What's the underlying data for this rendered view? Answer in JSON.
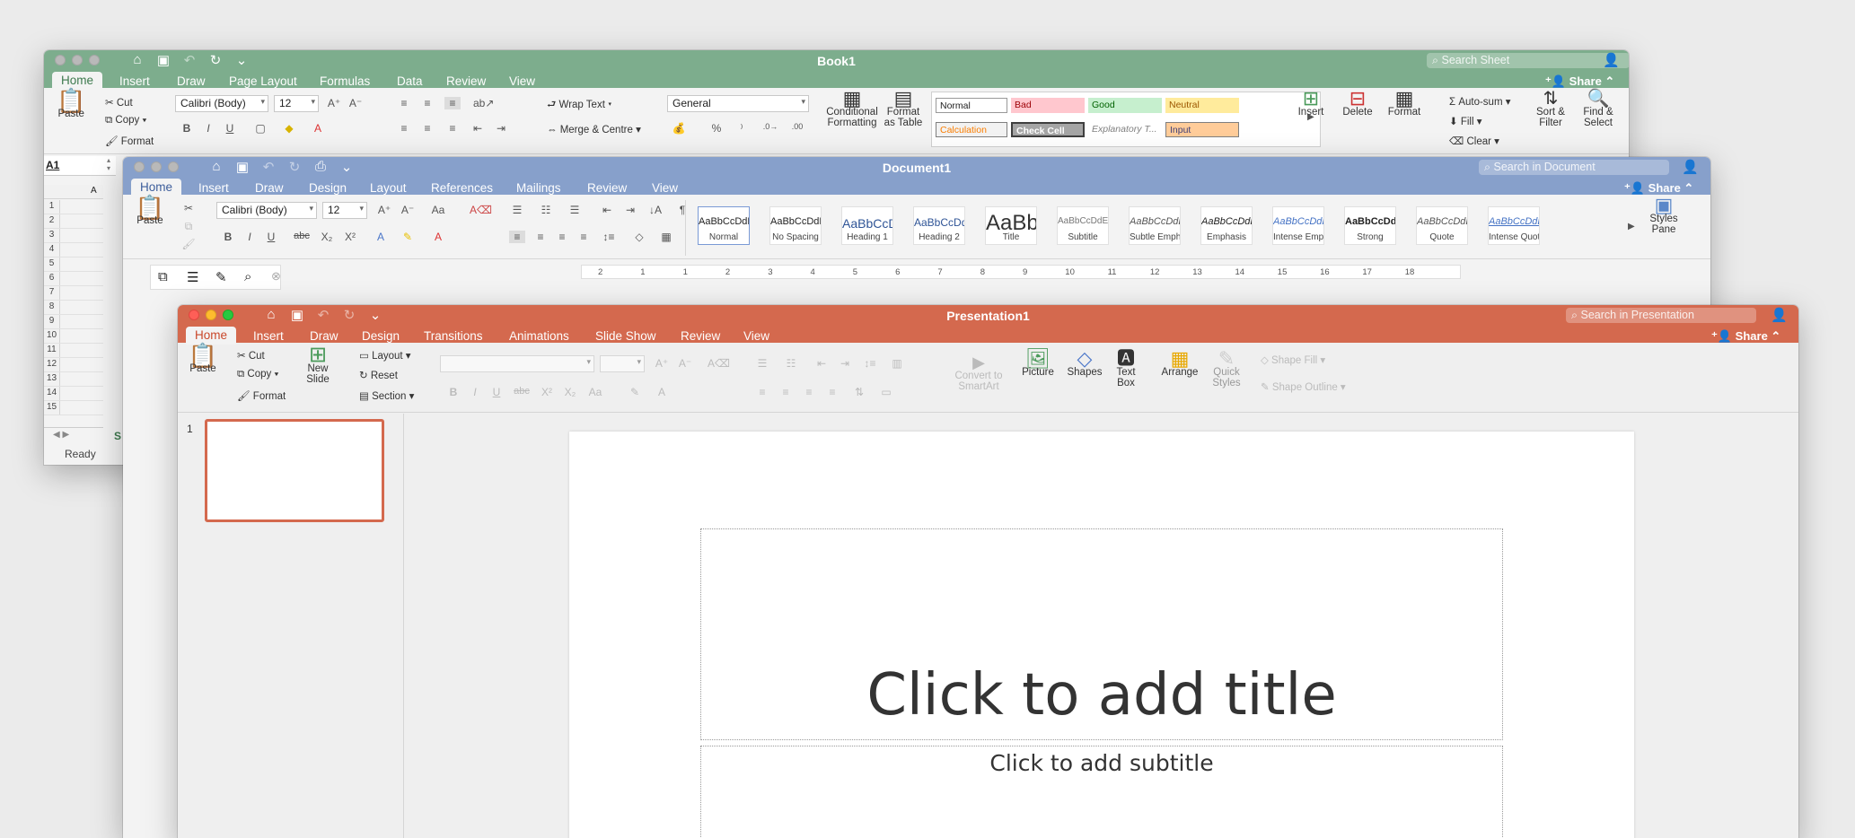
{
  "excel": {
    "title": "Book1",
    "search_placeholder": "Search Sheet",
    "tabs": [
      "Home",
      "Insert",
      "Draw",
      "Page Layout",
      "Formulas",
      "Data",
      "Review",
      "View"
    ],
    "share": "Share",
    "clipboard": {
      "paste": "Paste",
      "cut": "Cut",
      "copy": "Copy",
      "format": "Format"
    },
    "font": "Calibri (Body)",
    "font_size": "12",
    "wrap_text": "Wrap Text",
    "merge": "Merge & Centre",
    "number_format": "General",
    "cond_format": [
      "Conditional",
      "Formatting"
    ],
    "format_table": [
      "Format",
      "as Table"
    ],
    "cell_styles": [
      "Normal",
      "Bad",
      "Good",
      "Neutral",
      "Calculation",
      "Check Cell",
      "Explanatory T...",
      "Input"
    ],
    "cells": {
      "insert": "Insert",
      "delete": "Delete",
      "format": "Format"
    },
    "editing": {
      "autosum": "Auto-sum",
      "fill": "Fill",
      "clear": "Clear",
      "sort": [
        "Sort &",
        "Filter"
      ],
      "find": [
        "Find &",
        "Select"
      ]
    },
    "name_box": "A1",
    "col_header": "A",
    "rows": [
      "1",
      "2",
      "3",
      "4",
      "5",
      "6",
      "7",
      "8",
      "9",
      "10",
      "11",
      "12",
      "13",
      "14",
      "15"
    ],
    "sheet_tab": "S",
    "status": "Ready",
    "accent": "#7dad8d"
  },
  "word": {
    "title": "Document1",
    "search_placeholder": "Search in Document",
    "tabs": [
      "Home",
      "Insert",
      "Draw",
      "Design",
      "Layout",
      "References",
      "Mailings",
      "Review",
      "View"
    ],
    "share": "Share",
    "paste": "Paste",
    "font": "Calibri (Body)",
    "font_size": "12",
    "styles": [
      {
        "sample": "AaBbCcDdEe",
        "name": "Normal"
      },
      {
        "sample": "AaBbCcDdEe",
        "name": "No Spacing"
      },
      {
        "sample": "AaBbCcDc",
        "name": "Heading 1"
      },
      {
        "sample": "AaBbCcDdEe",
        "name": "Heading 2"
      },
      {
        "sample": "AaBb(",
        "name": "Title"
      },
      {
        "sample": "AaBbCcDdEe",
        "name": "Subtitle"
      },
      {
        "sample": "AaBbCcDdEe",
        "name": "Subtle Emph..."
      },
      {
        "sample": "AaBbCcDdEe",
        "name": "Emphasis"
      },
      {
        "sample": "AaBbCcDdEe",
        "name": "Intense Emp..."
      },
      {
        "sample": "AaBbCcDdEe",
        "name": "Strong"
      },
      {
        "sample": "AaBbCcDdEe",
        "name": "Quote"
      },
      {
        "sample": "AaBbCcDdEe",
        "name": "Intense Quote"
      }
    ],
    "styles_pane": [
      "Styles",
      "Pane"
    ],
    "ruler": [
      "2",
      "1",
      "1",
      "2",
      "3",
      "4",
      "5",
      "6",
      "7",
      "8",
      "9",
      "10",
      "11",
      "12",
      "13",
      "14",
      "15",
      "16",
      "17",
      "18"
    ],
    "accent": "#87a0cb"
  },
  "powerpoint": {
    "title": "Presentation1",
    "search_placeholder": "Search in Presentation",
    "tabs": [
      "Home",
      "Insert",
      "Draw",
      "Design",
      "Transitions",
      "Animations",
      "Slide Show",
      "Review",
      "View"
    ],
    "share": "Share",
    "clipboard": {
      "paste": "Paste",
      "cut": "Cut",
      "copy": "Copy",
      "format": "Format"
    },
    "new_slide": [
      "New",
      "Slide"
    ],
    "slides": {
      "layout": "Layout",
      "reset": "Reset",
      "section": "Section"
    },
    "convert": [
      "Convert to",
      "SmartArt"
    ],
    "picture": "Picture",
    "shapes": "Shapes",
    "text_box": [
      "Text",
      "Box"
    ],
    "arrange": "Arrange",
    "quick_styles": [
      "Quick",
      "Styles"
    ],
    "shape_fill": "Shape Fill",
    "shape_outline": "Shape Outline",
    "slide_number": "1",
    "slide_title": "Click to add title",
    "slide_subtitle": "Click to add subtitle",
    "accent": "#d4694e"
  }
}
